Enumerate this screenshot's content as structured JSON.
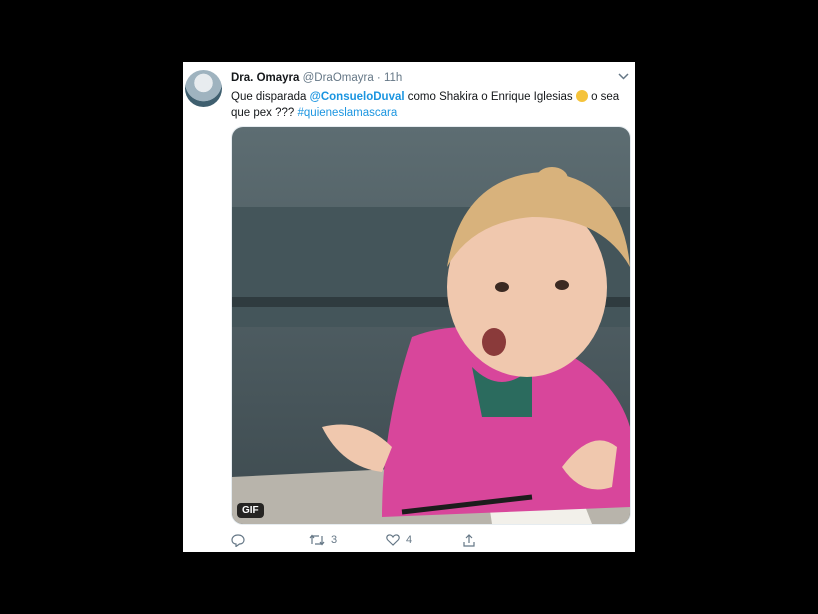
{
  "tweet": {
    "author_name": "Dra. Omayra",
    "handle": "@DraOmayra",
    "separator": "·",
    "time": "11h",
    "text_before": "Que disparada ",
    "mention": "@ConsueloDuval",
    "text_middle": " como Shakira o Enrique Iglesias ",
    "emoji": "sweat-smile-emoji",
    "text_after": " o sea que pex ??? ",
    "hashtag": "#quieneslamascara",
    "media_badge": "GIF",
    "reply_count": "",
    "retweet_count": "3",
    "like_count": "4"
  },
  "icons": {
    "menu": "chevron-down-icon",
    "reply": "reply-icon",
    "retweet": "retweet-icon",
    "like": "heart-icon",
    "share": "share-icon"
  },
  "colors": {
    "background": "#000000",
    "card": "#ffffff",
    "link": "#1b95e0",
    "muted": "#657786"
  }
}
